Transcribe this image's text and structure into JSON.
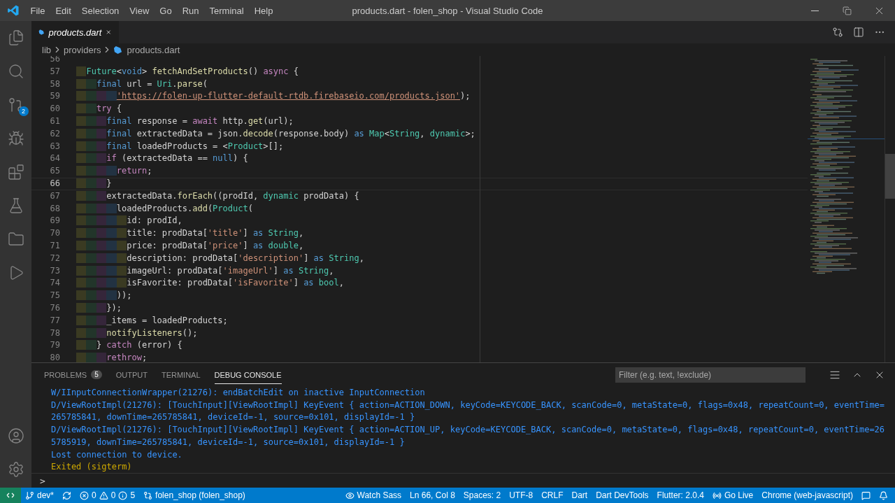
{
  "window": {
    "title": "products.dart - folen_shop - Visual Studio Code"
  },
  "menu": [
    "File",
    "Edit",
    "Selection",
    "View",
    "Go",
    "Run",
    "Terminal",
    "Help"
  ],
  "activity_bar": {
    "source_control_badge": "2"
  },
  "tabs": [
    {
      "label": "products.dart",
      "selected": true,
      "preview": true
    }
  ],
  "breadcrumb": [
    "lib",
    "providers",
    "products.dart"
  ],
  "code": [
    {
      "number": "56"
    },
    {
      "number": "57",
      "tokens": [
        {
          "kind": "type",
          "text": "  Future"
        },
        {
          "kind": "plain",
          "text": "<"
        },
        {
          "kind": "kw",
          "text": "void"
        },
        {
          "kind": "plain",
          "text": "> "
        },
        {
          "kind": "fn",
          "text": "fetchAndSetProducts"
        },
        {
          "kind": "plain",
          "text": "() "
        },
        {
          "kind": "ctrl",
          "text": "async"
        },
        {
          "kind": "plain",
          "text": " {"
        }
      ]
    },
    {
      "number": "58",
      "tokens": [
        {
          "kind": "kw",
          "text": "    final"
        },
        {
          "kind": "plain",
          "text": " url = "
        },
        {
          "kind": "type",
          "text": "Uri"
        },
        {
          "kind": "plain",
          "text": "."
        },
        {
          "kind": "fn",
          "text": "parse"
        },
        {
          "kind": "plain",
          "text": "("
        }
      ]
    },
    {
      "number": "59",
      "tokens": [
        {
          "kind": "link",
          "text": "        'https://folen-up-flutter-default-rtdb.firebaseio.com/products.json'"
        },
        {
          "kind": "plain",
          "text": ");"
        }
      ]
    },
    {
      "number": "60",
      "tokens": [
        {
          "kind": "ctrl",
          "text": "    try"
        },
        {
          "kind": "plain",
          "text": " {"
        }
      ]
    },
    {
      "number": "61",
      "tokens": [
        {
          "kind": "kw",
          "text": "      final"
        },
        {
          "kind": "plain",
          "text": " response = "
        },
        {
          "kind": "ctrl",
          "text": "await"
        },
        {
          "kind": "plain",
          "text": " http."
        },
        {
          "kind": "fn",
          "text": "get"
        },
        {
          "kind": "plain",
          "text": "(url);"
        }
      ]
    },
    {
      "number": "62",
      "tokens": [
        {
          "kind": "kw",
          "text": "      final"
        },
        {
          "kind": "plain",
          "text": " extractedData = json."
        },
        {
          "kind": "fn",
          "text": "decode"
        },
        {
          "kind": "plain",
          "text": "(response.body) "
        },
        {
          "kind": "kw",
          "text": "as"
        },
        {
          "kind": "type",
          "text": " Map"
        },
        {
          "kind": "plain",
          "text": "<"
        },
        {
          "kind": "type",
          "text": "String"
        },
        {
          "kind": "plain",
          "text": ", "
        },
        {
          "kind": "type",
          "text": "dynamic"
        },
        {
          "kind": "plain",
          "text": ">;"
        }
      ]
    },
    {
      "number": "63",
      "tokens": [
        {
          "kind": "kw",
          "text": "      final"
        },
        {
          "kind": "plain",
          "text": " loadedProducts = <"
        },
        {
          "kind": "type",
          "text": "Product"
        },
        {
          "kind": "plain",
          "text": ">[];"
        }
      ]
    },
    {
      "number": "64",
      "tokens": [
        {
          "kind": "ctrl",
          "text": "      if"
        },
        {
          "kind": "plain",
          "text": " (extractedData == "
        },
        {
          "kind": "kw",
          "text": "null"
        },
        {
          "kind": "plain",
          "text": ") {"
        }
      ]
    },
    {
      "number": "65",
      "tokens": [
        {
          "kind": "ctrl",
          "text": "        return"
        },
        {
          "kind": "plain",
          "text": ";"
        }
      ]
    },
    {
      "number": "66",
      "current": true,
      "tokens": [
        {
          "kind": "plain",
          "text": "      }"
        }
      ]
    },
    {
      "number": "67",
      "tokens": [
        {
          "kind": "plain",
          "text": "      extractedData."
        },
        {
          "kind": "fn",
          "text": "forEach"
        },
        {
          "kind": "plain",
          "text": "((prodId, "
        },
        {
          "kind": "type",
          "text": "dynamic"
        },
        {
          "kind": "plain",
          "text": " prodData) {"
        }
      ]
    },
    {
      "number": "68",
      "tokens": [
        {
          "kind": "plain",
          "text": "        loadedProducts."
        },
        {
          "kind": "fn",
          "text": "add"
        },
        {
          "kind": "plain",
          "text": "("
        },
        {
          "kind": "type",
          "text": "Product"
        },
        {
          "kind": "plain",
          "text": "("
        }
      ]
    },
    {
      "number": "69",
      "tokens": [
        {
          "kind": "plain",
          "text": "          id: prodId,"
        }
      ]
    },
    {
      "number": "70",
      "tokens": [
        {
          "kind": "plain",
          "text": "          title: prodData["
        },
        {
          "kind": "str",
          "text": "'title'"
        },
        {
          "kind": "plain",
          "text": "] "
        },
        {
          "kind": "kw",
          "text": "as"
        },
        {
          "kind": "type",
          "text": " String"
        },
        {
          "kind": "plain",
          "text": ","
        }
      ]
    },
    {
      "number": "71",
      "tokens": [
        {
          "kind": "plain",
          "text": "          price: prodData["
        },
        {
          "kind": "str",
          "text": "'price'"
        },
        {
          "kind": "plain",
          "text": "] "
        },
        {
          "kind": "kw",
          "text": "as"
        },
        {
          "kind": "type",
          "text": " double"
        },
        {
          "kind": "plain",
          "text": ","
        }
      ]
    },
    {
      "number": "72",
      "tokens": [
        {
          "kind": "plain",
          "text": "          description: prodData["
        },
        {
          "kind": "str",
          "text": "'description'"
        },
        {
          "kind": "plain",
          "text": "] "
        },
        {
          "kind": "kw",
          "text": "as"
        },
        {
          "kind": "type",
          "text": " String"
        },
        {
          "kind": "plain",
          "text": ","
        }
      ]
    },
    {
      "number": "73",
      "tokens": [
        {
          "kind": "plain",
          "text": "          imageUrl: prodData["
        },
        {
          "kind": "str",
          "text": "'imageUrl'"
        },
        {
          "kind": "plain",
          "text": "] "
        },
        {
          "kind": "kw",
          "text": "as"
        },
        {
          "kind": "type",
          "text": " String"
        },
        {
          "kind": "plain",
          "text": ","
        }
      ]
    },
    {
      "number": "74",
      "tokens": [
        {
          "kind": "plain",
          "text": "          isFavorite: prodData["
        },
        {
          "kind": "str",
          "text": "'isFavorite'"
        },
        {
          "kind": "plain",
          "text": "] "
        },
        {
          "kind": "kw",
          "text": "as"
        },
        {
          "kind": "type",
          "text": " bool"
        },
        {
          "kind": "plain",
          "text": ","
        }
      ]
    },
    {
      "number": "75",
      "tokens": [
        {
          "kind": "plain",
          "text": "        ));"
        }
      ]
    },
    {
      "number": "76",
      "tokens": [
        {
          "kind": "plain",
          "text": "      });"
        }
      ]
    },
    {
      "number": "77",
      "tokens": [
        {
          "kind": "plain",
          "text": "      _items = loadedProducts;"
        }
      ]
    },
    {
      "number": "78",
      "tokens": [
        {
          "kind": "fn",
          "text": "      notifyListeners"
        },
        {
          "kind": "plain",
          "text": "();"
        }
      ]
    },
    {
      "number": "79",
      "tokens": [
        {
          "kind": "plain",
          "text": "    } "
        },
        {
          "kind": "ctrl",
          "text": "catch"
        },
        {
          "kind": "plain",
          "text": " (error) {"
        }
      ]
    },
    {
      "number": "80",
      "tokens": [
        {
          "kind": "ctrl",
          "text": "      rethrow"
        },
        {
          "kind": "plain",
          "text": ";"
        }
      ]
    }
  ],
  "panel": {
    "tabs": [
      {
        "label": "PROBLEMS",
        "badge": "5",
        "selected": false
      },
      {
        "label": "OUTPUT",
        "selected": false
      },
      {
        "label": "TERMINAL",
        "selected": false
      },
      {
        "label": "DEBUG CONSOLE",
        "selected": true
      }
    ],
    "filter": {
      "placeholder": "Filter (e.g. text, !exclude)"
    },
    "console": [
      {
        "kind": "info",
        "text": "W/IInputConnectionWrapper(21276): endBatchEdit on inactive InputConnection"
      },
      {
        "kind": "info",
        "text": "D/ViewRootImpl(21276): [TouchInput][ViewRootImpl] KeyEvent { action=ACTION_DOWN, keyCode=KEYCODE_BACK, scanCode=0, metaState=0, flags=0x48, repeatCount=0, eventTime=265785841, downTime=265785841, deviceId=-1, source=0x101, displayId=-1 }"
      },
      {
        "kind": "info",
        "text": "D/ViewRootImpl(21276): [TouchInput][ViewRootImpl] KeyEvent { action=ACTION_UP, keyCode=KEYCODE_BACK, scanCode=0, metaState=0, flags=0x48, repeatCount=0, eventTime=265785919, downTime=265785841, deviceId=-1, source=0x101, displayId=-1 }"
      },
      {
        "kind": "info",
        "text": "Lost connection to device."
      },
      {
        "kind": "warning",
        "text": "Exited (sigterm)"
      }
    ],
    "prompt": ">"
  },
  "status_bar": {
    "branch": "dev*",
    "errors": "0",
    "warnings": "0",
    "infos": "5",
    "project": "folen_shop (folen_shop)",
    "watch_sass": "Watch Sass",
    "position": "Ln 66, Col 8",
    "indentation": "Spaces: 2",
    "encoding": "UTF-8",
    "eol": "CRLF",
    "language": "Dart",
    "devtools": "Dart DevTools",
    "flutter": "Flutter: 2.0.4",
    "go_live": "Go Live",
    "target": "Chrome (web-javascript)"
  }
}
